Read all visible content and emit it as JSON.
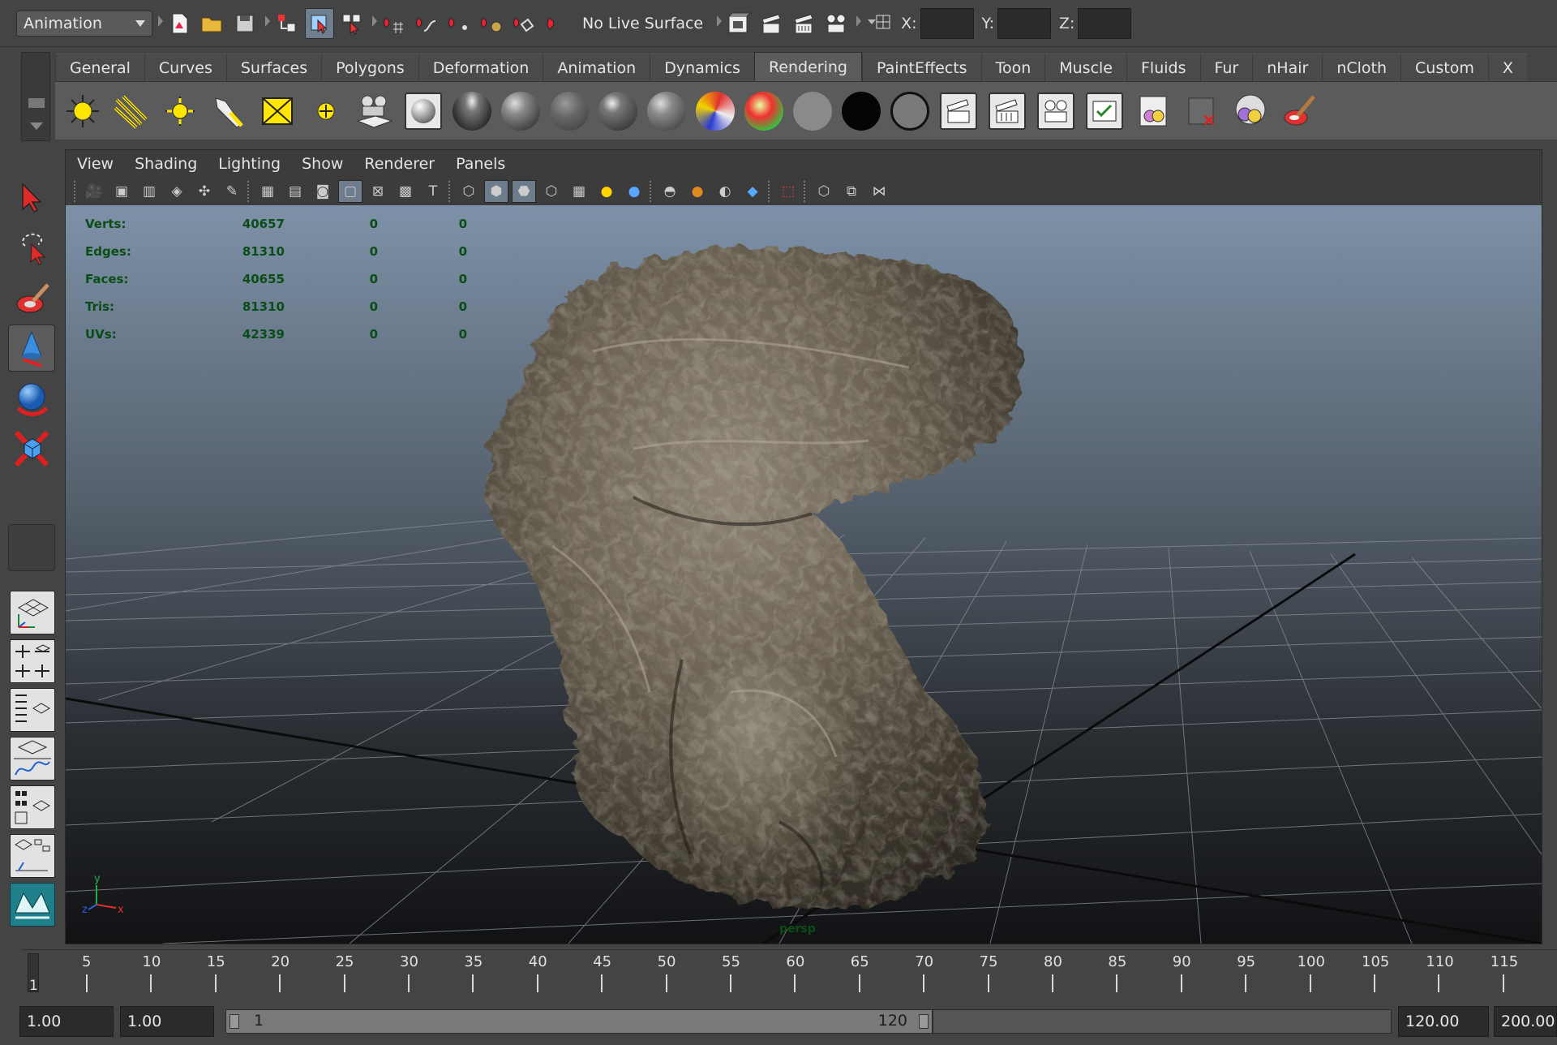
{
  "statusline": {
    "mode": "Animation",
    "live_surface": "No Live Surface",
    "x_label": "X:",
    "y_label": "Y:",
    "z_label": "Z:",
    "x_value": "",
    "y_value": "",
    "z_value": ""
  },
  "shelf": {
    "tabs": [
      "General",
      "Curves",
      "Surfaces",
      "Polygons",
      "Deformation",
      "Animation",
      "Dynamics",
      "Rendering",
      "PaintEffects",
      "Toon",
      "Muscle",
      "Fluids",
      "Fur",
      "nHair",
      "nCloth",
      "Custom",
      "X"
    ],
    "active_tab": "Rendering"
  },
  "panel": {
    "menus": [
      "View",
      "Shading",
      "Lighting",
      "Show",
      "Renderer",
      "Panels"
    ],
    "camera": "persp"
  },
  "hud": [
    {
      "label": "Verts:",
      "v1": "40657",
      "v2": "0",
      "v3": "0"
    },
    {
      "label": "Edges:",
      "v1": "81310",
      "v2": "0",
      "v3": "0"
    },
    {
      "label": "Faces:",
      "v1": "40655",
      "v2": "0",
      "v3": "0"
    },
    {
      "label": "Tris:",
      "v1": "81310",
      "v2": "0",
      "v3": "0"
    },
    {
      "label": "UVs:",
      "v1": "42339",
      "v2": "0",
      "v3": "0"
    }
  ],
  "timeline": {
    "current_frame": "1",
    "ticks": [
      "5",
      "10",
      "15",
      "20",
      "25",
      "30",
      "35",
      "40",
      "45",
      "50",
      "55",
      "60",
      "65",
      "70",
      "75",
      "80",
      "85",
      "90",
      "95",
      "100",
      "105",
      "110",
      "115"
    ]
  },
  "range": {
    "start_time": "1.00",
    "playback_start": "1.00",
    "slider_start": "1",
    "slider_end": "120",
    "playback_end": "120.00",
    "end_time": "200.00"
  },
  "colors": {
    "viewport_top": "#7d91a8",
    "viewport_bottom": "#111214",
    "hud_text": "#0b4d16",
    "rock": "#6b6253"
  }
}
